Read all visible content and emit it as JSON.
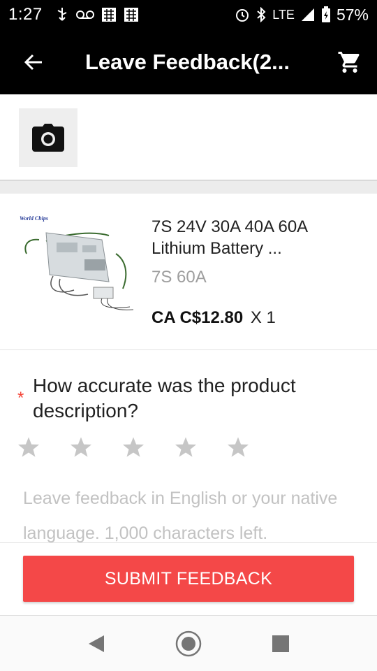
{
  "status_bar": {
    "time": "1:27",
    "network": "LTE",
    "battery": "57%"
  },
  "app_bar": {
    "title": "Leave Feedback(2..."
  },
  "product": {
    "title": "7S 24V 30A 40A 60A Lithium Battery ...",
    "variant": "7S 60A",
    "price": "CA C$12.80",
    "quantity": "X 1",
    "image_brand_text": "World Chips"
  },
  "question": {
    "required_mark": "*",
    "text": "How accurate was the product description?",
    "rating": 0,
    "max_rating": 5
  },
  "feedback": {
    "placeholder": "Leave feedback in English or your native language. 1,000 characters left."
  },
  "submit_button": {
    "label": "SUBMIT FEEDBACK"
  },
  "colors": {
    "accent": "#f44848",
    "star_empty": "#c6c6c6",
    "required": "#f44336"
  }
}
